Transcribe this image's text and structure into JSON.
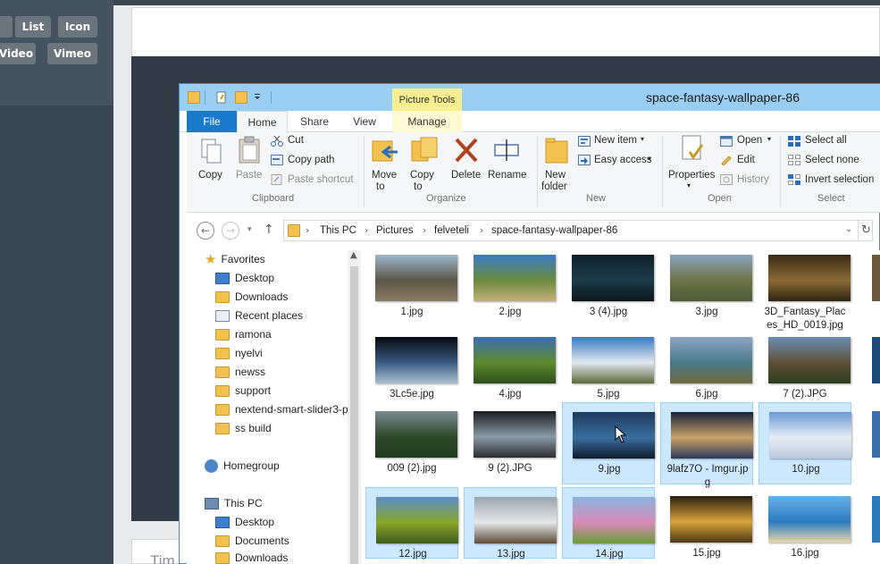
{
  "bg": {
    "pills_row1": [
      "List",
      "Icon"
    ],
    "pills_row2": [
      "Video",
      "Vimeo"
    ],
    "bottom_heading": "Tim"
  },
  "window": {
    "title": "space-fantasy-wallpaper-86",
    "context_tab": "Picture Tools",
    "tabs": [
      "File",
      "Home",
      "Share",
      "View",
      "Manage"
    ]
  },
  "ribbon": {
    "clipboard": {
      "copy": "Copy",
      "paste": "Paste",
      "cut": "Cut",
      "copy_path": "Copy path",
      "paste_shortcut": "Paste shortcut",
      "group": "Clipboard"
    },
    "organize": {
      "move_to_1": "Move",
      "move_to_2": "to",
      "copy_to_1": "Copy",
      "copy_to_2": "to",
      "delete": "Delete",
      "rename": "Rename",
      "group": "Organize"
    },
    "new": {
      "new_folder_1": "New",
      "new_folder_2": "folder",
      "new_item": "New item",
      "easy_access": "Easy access",
      "group": "New"
    },
    "open": {
      "properties": "Properties",
      "open": "Open",
      "edit": "Edit",
      "history": "History",
      "group": "Open"
    },
    "select": {
      "select_all": "Select all",
      "select_none": "Select none",
      "invert_selection": "Invert selection",
      "group": "Select"
    }
  },
  "address": {
    "crumbs": [
      "This PC",
      "Pictures",
      "felveteli",
      "space-fantasy-wallpaper-86"
    ]
  },
  "nav": {
    "favorites": "Favorites",
    "items": [
      "Desktop",
      "Downloads",
      "Recent places",
      "ramona",
      "nyelvi",
      "newss",
      "support",
      "nextend-smart-slider3-p",
      "ss build"
    ],
    "homegroup": "Homegroup",
    "thispc": "This PC",
    "pc_items": [
      "Desktop",
      "Documents",
      "Downloads"
    ]
  },
  "files": [
    {
      "name": "1.jpg",
      "colors": [
        "#9db8cc",
        "#5b5648",
        "#8a7b63"
      ],
      "selected": false
    },
    {
      "name": "2.jpg",
      "colors": [
        "#3b7bc5",
        "#6a8a3c",
        "#c5b07a"
      ],
      "selected": false
    },
    {
      "name": "3 (4).jpg",
      "colors": [
        "#0f1f28",
        "#1d3c4a",
        "#0c1518"
      ],
      "selected": false
    },
    {
      "name": "3.jpg",
      "colors": [
        "#8aa3bd",
        "#6f7448",
        "#4d5b36"
      ],
      "selected": false
    },
    {
      "name": "3D_Fantasy_Places_HD_0019.jpg",
      "colors": [
        "#3a2a16",
        "#8a6a34",
        "#2e2412"
      ],
      "selected": false
    },
    {
      "name": "3Lc5e.jpg",
      "colors": [
        "#06090f",
        "#3a5a80",
        "#a8c0d0"
      ],
      "selected": false
    },
    {
      "name": "4.jpg",
      "colors": [
        "#3d6fb3",
        "#5e8a2e",
        "#2e4f1c"
      ],
      "selected": false
    },
    {
      "name": "5.jpg",
      "colors": [
        "#3b7ac2",
        "#e0e8ef",
        "#5b6a3a"
      ],
      "selected": false
    },
    {
      "name": "6.jpg",
      "colors": [
        "#8fa6c6",
        "#4a7a8a",
        "#6e6a3f"
      ],
      "selected": false
    },
    {
      "name": "7 (2).JPG",
      "colors": [
        "#6d8db2",
        "#5c5037",
        "#2c3c1e"
      ],
      "selected": false
    },
    {
      "name": "009 (2).jpg",
      "colors": [
        "#7a8a93",
        "#2e4a2a",
        "#1e3a1c"
      ],
      "selected": false
    },
    {
      "name": "9 (2).JPG",
      "colors": [
        "#1a1e24",
        "#8a9aa3",
        "#2a2d30"
      ],
      "selected": false
    },
    {
      "name": "9.jpg",
      "colors": [
        "#1d3a5c",
        "#3a6fa0",
        "#0e1a2a"
      ],
      "selected": true
    },
    {
      "name": "9lafz7O - Imgur.jpg",
      "colors": [
        "#18243a",
        "#c8a26a",
        "#2e3a5a"
      ],
      "selected": true
    },
    {
      "name": "10.jpg",
      "colors": [
        "#6a98d2",
        "#e8eef5",
        "#b8c8d8"
      ],
      "selected": true
    },
    {
      "name": "12.jpg",
      "colors": [
        "#5a8ec8",
        "#8aa62a",
        "#3e5a1c"
      ],
      "selected": true
    },
    {
      "name": "13.jpg",
      "colors": [
        "#9aa4ae",
        "#e6e8ea",
        "#5a4c3a"
      ],
      "selected": true
    },
    {
      "name": "14.jpg",
      "colors": [
        "#8ab4e0",
        "#d88ab8",
        "#6a9a3a"
      ],
      "selected": true
    },
    {
      "name": "15.jpg",
      "colors": [
        "#2a2010",
        "#d8a23a",
        "#4a3a18"
      ],
      "selected": false
    },
    {
      "name": "16.jpg",
      "colors": [
        "#6ab0e8",
        "#2a7ac0",
        "#e8d6a8"
      ],
      "selected": false
    }
  ],
  "colors": {
    "accent": "#1979ca",
    "titlebar": "#99cdf1",
    "selection": "#cce8ff"
  }
}
